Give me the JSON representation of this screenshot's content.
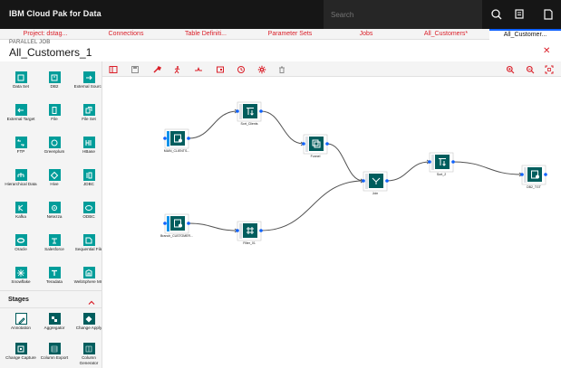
{
  "header": {
    "brand": "IBM Cloud Pak for Data",
    "search_placeholder": "Search"
  },
  "tabs": [
    {
      "label": "Project: dstag..."
    },
    {
      "label": "Connections"
    },
    {
      "label": "Table Definiti..."
    },
    {
      "label": "Parameter Sets"
    },
    {
      "label": "Jobs"
    },
    {
      "label": "All_Customers*"
    },
    {
      "label": "All_Customer..."
    }
  ],
  "job": {
    "type": "PARALLEL JOB",
    "title": "All_Customers_1"
  },
  "palette": {
    "connectors": [
      {
        "label": "Data Set",
        "icon": "data-set-icon"
      },
      {
        "label": "DB2",
        "icon": "db2-icon"
      },
      {
        "label": "External Source",
        "icon": "external-source-icon"
      },
      {
        "label": "External Target",
        "icon": "external-target-icon"
      },
      {
        "label": "File",
        "icon": "file-icon"
      },
      {
        "label": "File Set",
        "icon": "file-set-icon"
      },
      {
        "label": "FTP",
        "icon": "ftp-icon"
      },
      {
        "label": "Greenplum",
        "icon": "greenplum-icon"
      },
      {
        "label": "HBase",
        "icon": "hbase-icon"
      },
      {
        "label": "Hierarchical Data",
        "icon": "hierarchical-data-icon"
      },
      {
        "label": "Hive",
        "icon": "hive-icon"
      },
      {
        "label": "JDBC",
        "icon": "jdbc-icon"
      },
      {
        "label": "Kafka",
        "icon": "kafka-icon"
      },
      {
        "label": "Netezza",
        "icon": "netezza-icon"
      },
      {
        "label": "ODBC",
        "icon": "odbc-icon"
      },
      {
        "label": "Oracle",
        "icon": "oracle-icon"
      },
      {
        "label": "Salesforce",
        "icon": "salesforce-icon"
      },
      {
        "label": "Sequential File",
        "icon": "sequential-file-icon"
      },
      {
        "label": "Snowflake",
        "icon": "snowflake-icon"
      },
      {
        "label": "Teradata",
        "icon": "teradata-icon"
      },
      {
        "label": "WebSphere MQ",
        "icon": "websphere-mq-icon"
      }
    ],
    "stages_label": "Stages",
    "stages": [
      {
        "label": "Annotation",
        "icon": "annotation-icon"
      },
      {
        "label": "Aggregator",
        "icon": "aggregator-icon"
      },
      {
        "label": "Change Apply",
        "icon": "change-apply-icon"
      },
      {
        "label": "Change Capture",
        "icon": "change-capture-icon"
      },
      {
        "label": "Column Export",
        "icon": "column-export-icon"
      },
      {
        "label": "Column Generator",
        "icon": "column-generator-icon"
      }
    ]
  },
  "canvas": {
    "nodes": [
      {
        "label": "MAIN_CLIENTS...",
        "type": "source"
      },
      {
        "label": "Sort_Clients",
        "type": "sort"
      },
      {
        "label": "Funnel",
        "type": "funnel"
      },
      {
        "label": "Join",
        "type": "join"
      },
      {
        "label": "Sort_2",
        "type": "sort"
      },
      {
        "label": "DB2_TGT",
        "type": "target"
      },
      {
        "label": "Branch_CUSTOMER...",
        "type": "source"
      },
      {
        "label": "Filter_01",
        "type": "filter"
      }
    ]
  },
  "colors": {
    "accent": "#0f62fe",
    "link_red": "#da1e28",
    "node_teal": "#005d5d",
    "palette_teal": "#009d9a"
  }
}
